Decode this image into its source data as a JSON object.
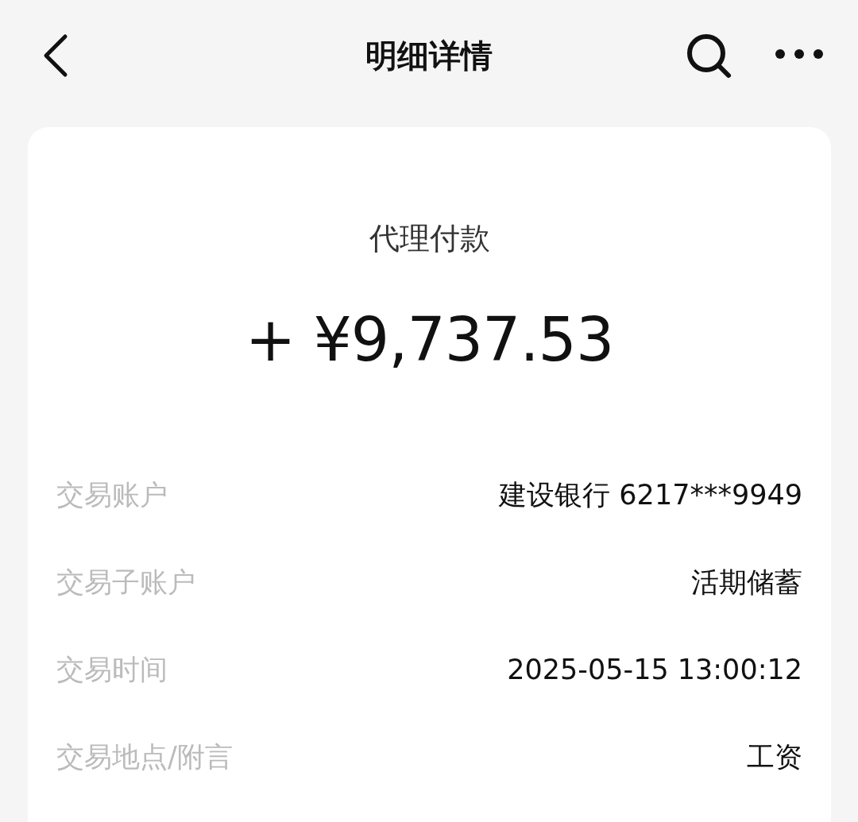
{
  "header": {
    "title": "明细详情"
  },
  "summary": {
    "type": "代理付款",
    "amount": "+ ¥9,737.53"
  },
  "details": [
    {
      "label": "交易账户",
      "value": "建设银行 6217***9949"
    },
    {
      "label": "交易子账户",
      "value": "活期储蓄"
    },
    {
      "label": "交易时间",
      "value": "2025-05-15 13:00:12"
    },
    {
      "label": "交易地点/附言",
      "value": "工资"
    }
  ]
}
